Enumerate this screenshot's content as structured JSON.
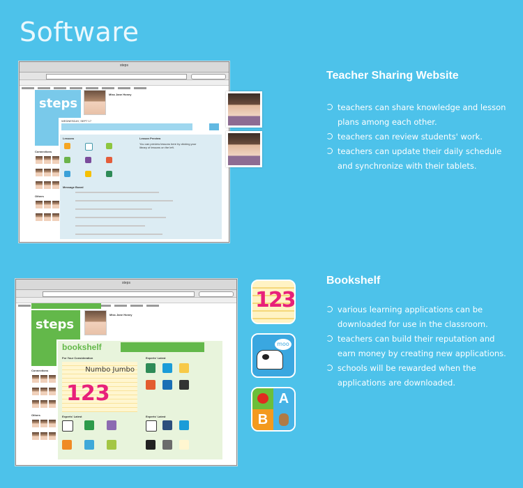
{
  "page_title": "Software",
  "teacher_site": {
    "heading": "Teacher Sharing Website",
    "bullets": [
      "teachers can share knowledge and lesson plans among each other.",
      "teachers can review students' work.",
      "teachers can update their daily schedule and synchronize with their tablets."
    ],
    "browser": {
      "window_title": "steps",
      "logo": "steps",
      "profile_name": "Miss Jane Honey",
      "schedule_label": "WEDNESDAY, SEPT 17",
      "sections": [
        "Lessons",
        "Lesson Preview",
        "Message Board"
      ],
      "preview_text": "You can preview lessons here by clicking your library of lessons on the left.",
      "connections_label": "Connections",
      "others_label": "Others"
    }
  },
  "bookshelf": {
    "heading": "Bookshelf",
    "bullets": [
      "various learning applications can be downloaded for use in the classroom.",
      "teachers can build their reputation and earn money by creating new applications.",
      "schools will be rewarded when the applications are downloaded."
    ],
    "browser": {
      "window_title": "steps",
      "logo": "steps",
      "section_title": "bookshelf",
      "profile_name": "Miss Jane Honey",
      "featured_title": "Numbo Jumbo",
      "featured_numbers": "123",
      "columns": [
        "For Your Consideration",
        "Experts' Latest",
        "Experts' Latest",
        "Experts' Latest"
      ],
      "connections_label": "Connections",
      "others_label": "Others"
    },
    "app_icons": [
      {
        "name": "123-numbers-app",
        "text": "123"
      },
      {
        "name": "cow-moo-app",
        "text": "moo"
      },
      {
        "name": "abc-blocks-app",
        "letters": [
          "A",
          "B"
        ]
      }
    ]
  }
}
